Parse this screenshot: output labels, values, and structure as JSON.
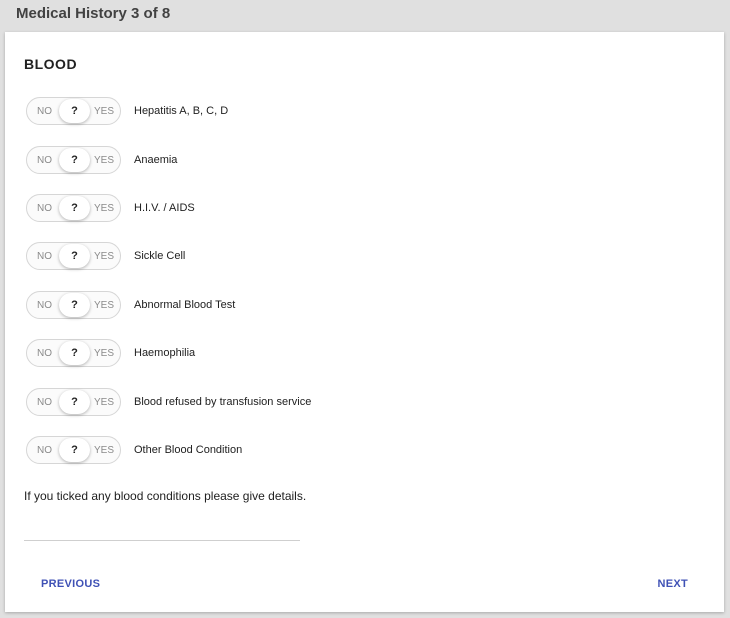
{
  "header": {
    "title": "Medical History 3 of 8"
  },
  "section": {
    "title": "BLOOD"
  },
  "toggle": {
    "no_label": "NO",
    "unknown_label": "?",
    "yes_label": "YES"
  },
  "conditions": [
    {
      "label": "Hepatitis A, B, C, D",
      "state": "unknown"
    },
    {
      "label": "Anaemia",
      "state": "unknown"
    },
    {
      "label": "H.I.V. / AIDS",
      "state": "unknown"
    },
    {
      "label": "Sickle Cell",
      "state": "unknown"
    },
    {
      "label": "Abnormal Blood Test",
      "state": "unknown"
    },
    {
      "label": "Haemophilia",
      "state": "unknown"
    },
    {
      "label": "Blood refused by transfusion service",
      "state": "unknown"
    },
    {
      "label": "Other Blood Condition",
      "state": "unknown"
    }
  ],
  "details": {
    "prompt": "If you ticked any blood conditions please give details.",
    "value": ""
  },
  "nav": {
    "previous_label": "PREVIOUS",
    "next_label": "NEXT"
  },
  "colors": {
    "accent": "#3f51b5",
    "background": "#e0e0e0",
    "card": "#ffffff"
  }
}
